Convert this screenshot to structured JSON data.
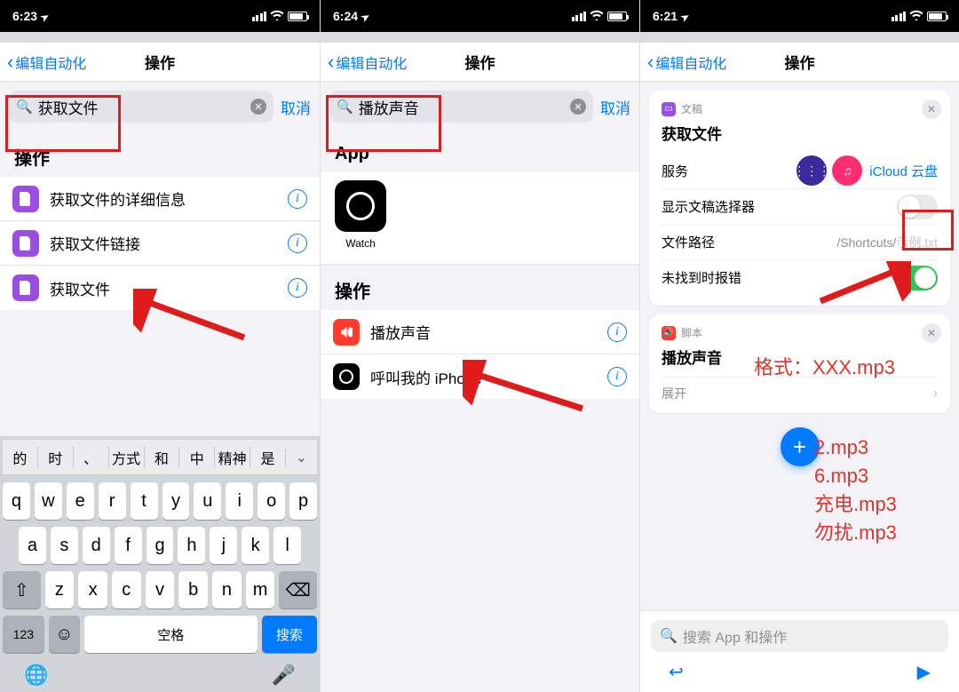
{
  "status": {
    "t1": "6:23",
    "t2": "6:24",
    "t3": "6:21",
    "sig_alt": "::!!"
  },
  "nav": {
    "back": "编辑自动化",
    "title": "操作"
  },
  "search": {
    "q1": "获取文件",
    "q2": "播放声音",
    "cancel": "取消"
  },
  "sections": {
    "actions": "操作",
    "app": "App"
  },
  "p1": {
    "rows": [
      {
        "label": "获取文件的详细信息"
      },
      {
        "label": "获取文件链接"
      },
      {
        "label": "获取文件"
      }
    ]
  },
  "p2": {
    "app_name": "Watch",
    "rows": [
      {
        "label": "播放声音"
      },
      {
        "label": "呼叫我的 iPhone"
      }
    ]
  },
  "p3": {
    "card1": {
      "cat": "文稿",
      "title": "获取文件",
      "service_label": "服务",
      "service_link": "iCloud 云盘",
      "picker_label": "显示文稿选择器",
      "path_label": "文件路径",
      "path_prefix": "/Shortcuts/",
      "path_placeholder": "示例.txt",
      "err_label": "未找到时报错"
    },
    "card2": {
      "cat": "脚本",
      "title": "播放声音",
      "expand": "展开"
    },
    "search_placeholder": "搜索 App 和操作"
  },
  "kbd": {
    "suggestions": [
      "的",
      "时",
      "、",
      "方式",
      "和",
      "中",
      "精神",
      "是"
    ],
    "r1": [
      "q",
      "w",
      "e",
      "r",
      "t",
      "y",
      "u",
      "i",
      "o",
      "p"
    ],
    "r2": [
      "a",
      "s",
      "d",
      "f",
      "g",
      "h",
      "j",
      "k",
      "l"
    ],
    "r3": [
      "z",
      "x",
      "c",
      "v",
      "b",
      "n",
      "m"
    ],
    "num": "123",
    "space": "空格",
    "search": "搜索"
  },
  "annot": {
    "format": "格式：XXX.mp3",
    "list": "2.mp3\n6.mp3\n充电.mp3\n勿扰.mp3"
  }
}
